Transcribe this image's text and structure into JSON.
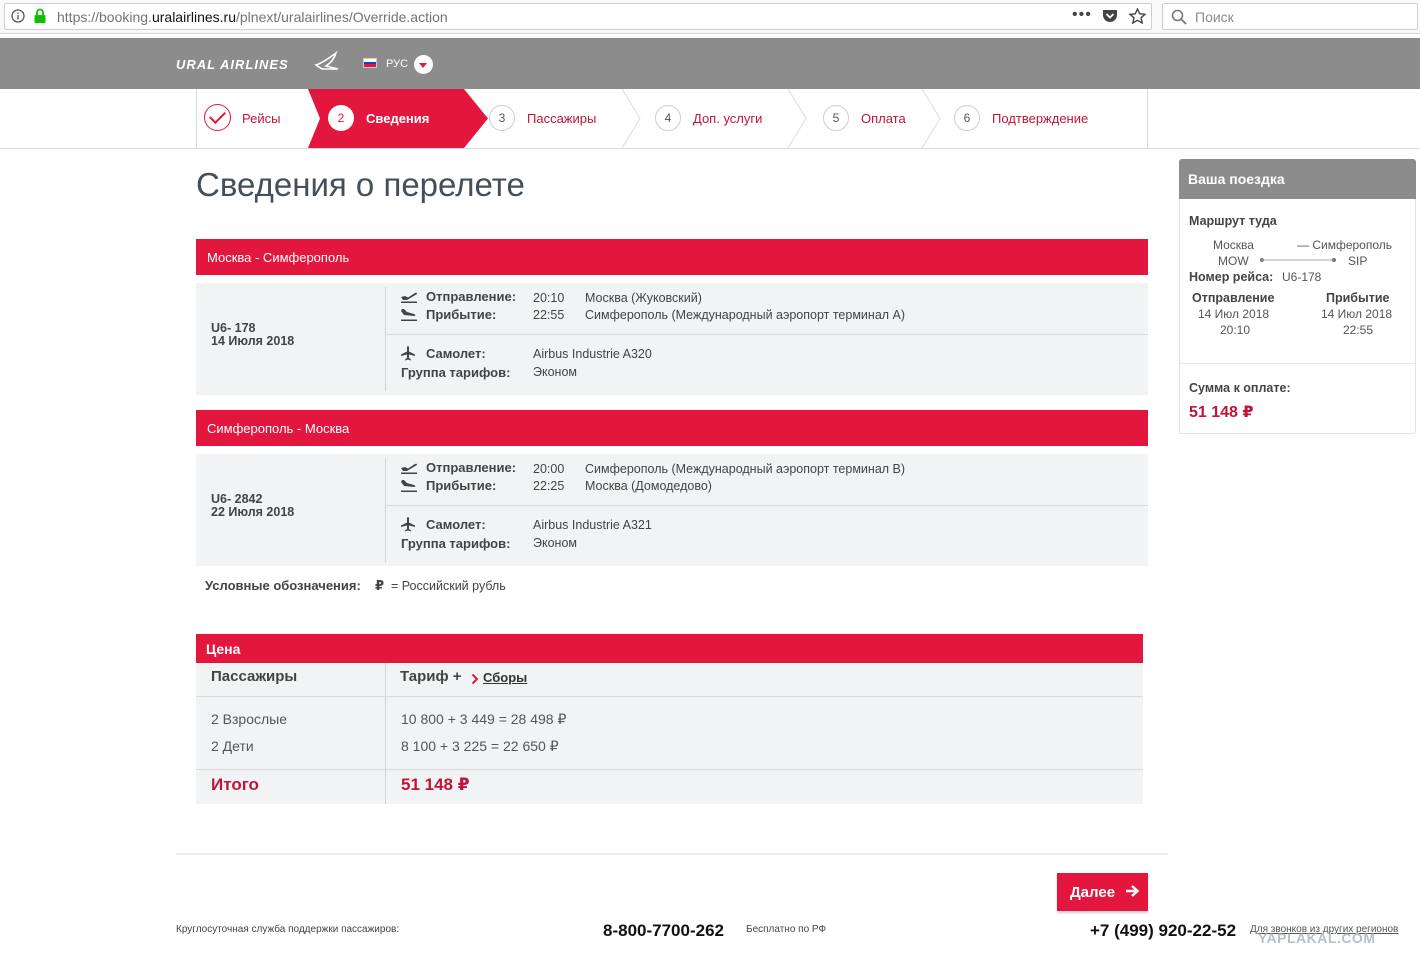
{
  "browser": {
    "url_prefix": "https://booking.",
    "url_domain": "uralairlines.ru",
    "url_path": "/plnext/uralairlines/Override.action",
    "search_placeholder": "Поиск"
  },
  "header": {
    "logo": "URAL AIRLINES",
    "language": "РУС"
  },
  "steps": [
    {
      "number": "",
      "label": "Рейсы"
    },
    {
      "number": "2",
      "label": "Сведения"
    },
    {
      "number": "3",
      "label": "Пассажиры"
    },
    {
      "number": "4",
      "label": "Доп. услуги"
    },
    {
      "number": "5",
      "label": "Оплата"
    },
    {
      "number": "6",
      "label": "Подтверждение"
    }
  ],
  "page_title": "Сведения о перелете",
  "labels": {
    "departure": "Отправление:",
    "arrival": "Прибытие:",
    "aircraft": "Самолет:",
    "fare_group": "Группа тарифов:"
  },
  "segments": [
    {
      "route": "Москва - Симферополь",
      "flight": "U6- 178",
      "date": "14 Июля 2018",
      "dep_time": "20:10",
      "dep_airport": "Москва (Жуковский)",
      "arr_time": "22:55",
      "arr_airport": "Симферополь (Международный аэропорт терминал А)",
      "aircraft": "Airbus Industrie A320",
      "fare": "Эконом"
    },
    {
      "route": "Симферополь - Москва",
      "flight": "U6- 2842",
      "date": "22 Июля 2018",
      "dep_time": "20:00",
      "dep_airport": "Симферополь (Международный аэропорт терминал В)",
      "arr_time": "22:25",
      "arr_airport": "Москва (Домодедово)",
      "aircraft": "Airbus Industrie A321",
      "fare": "Эконом"
    }
  ],
  "legend": {
    "label": "Условные обозначения:",
    "symbol": "₽",
    "text": "= Российский рубль"
  },
  "price": {
    "title": "Цена",
    "col_passengers": "Пассажиры",
    "col_fare": "Тариф +",
    "fees_link": "Сборы",
    "rows": [
      {
        "who": "2 Взрослые",
        "calc": "10 800 + 3 449 = 28 498 ₽"
      },
      {
        "who": "2 Дети",
        "calc": "8 100 + 3 225 = 22 650 ₽"
      }
    ],
    "total_label": "Итого",
    "total_value": "51 148 ₽"
  },
  "sidebar": {
    "title": "Ваша поездка",
    "route_label": "Маршрут туда",
    "from_city": "Москва",
    "from_code": "MOW",
    "to_city": "— Симферополь",
    "to_code": "SIP",
    "flight_label": "Номер рейса:",
    "flight_number": "U6-178",
    "dep_label": "Отправление",
    "dep_date": "14 Июл 2018",
    "dep_time": "20:10",
    "arr_label": "Прибытие",
    "arr_date": "14 Июл 2018",
    "arr_time": "22:55",
    "sum_label": "Сумма к оплате:",
    "sum_value": "51 148 ₽"
  },
  "footer": {
    "next_label": "Далее",
    "support_text": "Круглосуточная служба поддержки пассажиров:",
    "phone_free": "8-800-7700-262",
    "phone_free_note": "Бесплатно по РФ",
    "phone_other": "+7 (499) 920-22-52",
    "phone_other_note": "Для звонков из других регионов"
  },
  "watermark": "YAPLAKAL.COM",
  "colors": {
    "accent": "#e3173e",
    "header_gray": "#8c8c8c",
    "panel": "#f2f3f5"
  }
}
